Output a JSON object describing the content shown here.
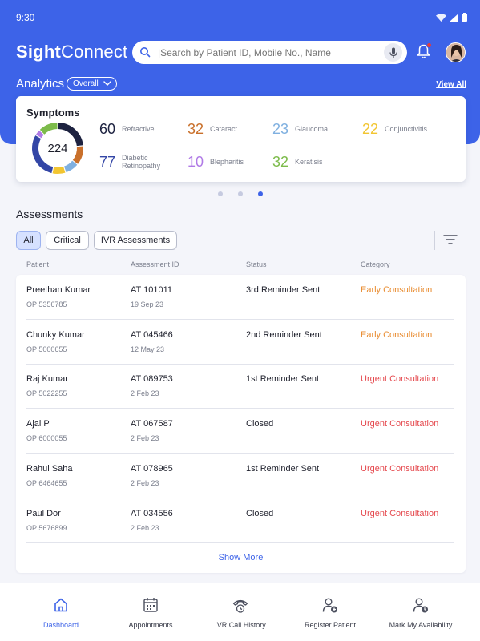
{
  "status_bar": {
    "time": "9:30"
  },
  "app": {
    "logo_bold": "Sight",
    "logo_light": "Connect"
  },
  "search": {
    "placeholder": "|Search by Patient ID, Mobile No., Name"
  },
  "analytics": {
    "title": "Analytics",
    "filter": "Overall",
    "view_all": "View All"
  },
  "symptoms": {
    "title": "Symptoms",
    "total": "224",
    "items": [
      {
        "value": "60",
        "label": "Refractive",
        "color": "#1d2240"
      },
      {
        "value": "32",
        "label": "Cataract",
        "color": "#c9702b"
      },
      {
        "value": "23",
        "label": "Glaucoma",
        "color": "#7fb0e0"
      },
      {
        "value": "22",
        "label": "Conjunctivitis",
        "color": "#f2c531"
      },
      {
        "value": "77",
        "label_line1": "Diabetic",
        "label_line2": "Retinopathy",
        "color": "#3346a6"
      },
      {
        "value": "10",
        "label": "Blepharitis",
        "color": "#b07ae6"
      },
      {
        "value": "32",
        "label": "Keratisis",
        "color": "#7cbb4a"
      }
    ]
  },
  "carousel": {
    "pages": 3,
    "active": 3
  },
  "assessments": {
    "title": "Assessments",
    "chips": [
      "All",
      "Critical",
      "IVR Assessments"
    ],
    "active_chip": "All",
    "columns": [
      "Patient",
      "Assessment ID",
      "Status",
      "Category"
    ],
    "rows": [
      {
        "name": "Preethan Kumar",
        "op": "OP 5356785",
        "id": "AT 101011",
        "date": "19 Sep 23",
        "status": "3rd Reminder Sent",
        "category": "Early Consultation"
      },
      {
        "name": "Chunky Kumar",
        "op": "OP 5000655",
        "id": "AT 045466",
        "date": "12 May 23",
        "status": "2nd Reminder Sent",
        "category": "Early Consultation"
      },
      {
        "name": "Raj Kumar",
        "op": "OP 5022255",
        "id": "AT 089753",
        "date": "2 Feb 23",
        "status": "1st Reminder Sent",
        "category": "Urgent Consultation"
      },
      {
        "name": "Ajai P",
        "op": "OP 6000055",
        "id": "AT 067587",
        "date": "2 Feb 23",
        "status": "Closed",
        "category": "Urgent Consultation"
      },
      {
        "name": "Rahul Saha",
        "op": "OP 6464655",
        "id": "AT 078965",
        "date": "2 Feb 23",
        "status": "1st Reminder Sent",
        "category": "Urgent Consultation"
      },
      {
        "name": "Paul Dor",
        "op": "OP 5676899",
        "id": "AT 034556",
        "date": "2 Feb 23",
        "status": "Closed",
        "category": "Urgent Consultation"
      }
    ],
    "show_more": "Show More"
  },
  "bottom_nav": {
    "items": [
      {
        "label": "Dashboard",
        "icon": "home-icon"
      },
      {
        "label": "Appointments",
        "icon": "calendar-icon"
      },
      {
        "label": "IVR Call History",
        "icon": "phone-history-icon"
      },
      {
        "label": "Register Patient",
        "icon": "add-user-icon"
      },
      {
        "label": "Mark My Availability",
        "icon": "user-clock-icon"
      }
    ],
    "active": "Dashboard"
  },
  "colors": {
    "brand": "#3d63e8",
    "early": "#e88a2d",
    "urgent": "#e5484d"
  }
}
